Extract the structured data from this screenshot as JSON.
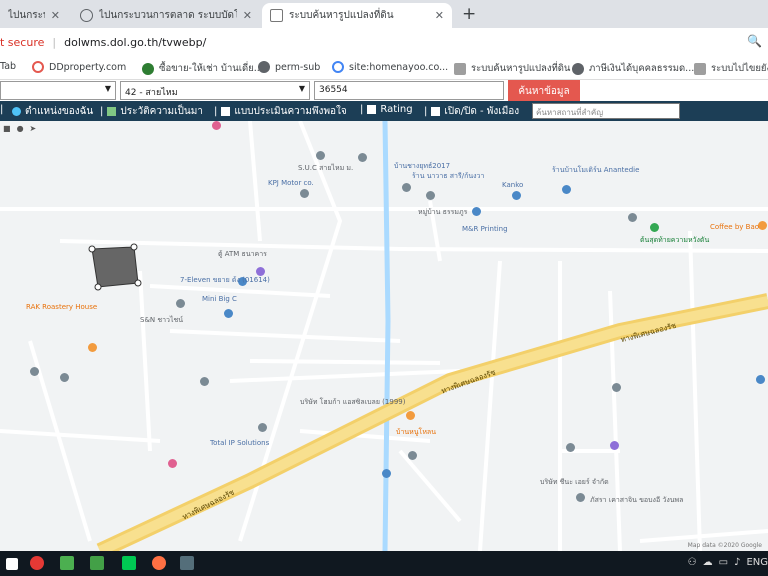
{
  "tabs": [
    {
      "title": "ไปนกระบวนการตลาด ระบบบัดโนมิดิ เ",
      "close": "✕",
      "active": false
    },
    {
      "title": "ไปนกระบวนการตลาด ระบบบัดโนมิดิ ม์",
      "close": "✕",
      "active": false
    },
    {
      "title": "ระบบค้นหารูปแปลงที่ดิน",
      "close": "✕",
      "active": true
    }
  ],
  "newtab_label": "+",
  "address": {
    "security": "t secure",
    "url": "dolwms.dol.go.th/tvwebp/",
    "zoom_icon": "🔍"
  },
  "bookmarks": [
    {
      "label": "Tab",
      "icon": "bookmark-icon",
      "color": "#888888"
    },
    {
      "label": "DDproperty.com",
      "icon": "ddproperty-icon",
      "color": "#e4584f"
    },
    {
      "label": "ซื้อขาย-ให้เช่า บ้านเดี่ย...",
      "icon": "home-icon",
      "color": "#2e7d32"
    },
    {
      "label": "perm-sub",
      "icon": "globe-icon",
      "color": "#5f6368"
    },
    {
      "label": "site:homenayoo.co...",
      "icon": "google-icon",
      "color": "#4285f4"
    },
    {
      "label": "ระบบค้นหารูปแปลงที่ดิน",
      "icon": "dol-icon",
      "color": "#5f6368"
    },
    {
      "label": "ภาษีเงินได้บุคคลธรรมด...",
      "icon": "globe-icon",
      "color": "#5f6368"
    },
    {
      "label": "ระบบไปไขยยังโฉ้...",
      "icon": "dol-icon",
      "color": "#5f6368"
    }
  ],
  "filters": {
    "province": "",
    "district": "42 - สายไหม",
    "parcel_no": "36554",
    "search_button": "ค้นหาข้อมูล"
  },
  "nav": {
    "items": [
      {
        "label": "ตำแหน่งของฉัน",
        "icon": "location-icon"
      },
      {
        "label": "ประวัติความเป็นมา",
        "icon": "history-icon"
      },
      {
        "label": "แบบประเมินความพึงพอใจ",
        "icon": "form-icon"
      },
      {
        "label": "Rating",
        "icon": "rating-icon"
      },
      {
        "label": "เปิด/ปิด - พังเมือง",
        "icon": "toggle-icon"
      }
    ],
    "search_placeholder": "ค้นหาสถานที่สำคัญ"
  },
  "map": {
    "place_labels": [
      "S.U.C สายไหม ม.",
      "KPJ Motor co.",
      "บ้านชางยุทธ์2017",
      "ร้าน นาวาธ สารี/ก้นงวา",
      "Kanko",
      "ร้านบ้านโมเดิร์น Anantedie",
      "Coffee by Bao",
      "ต้นสุดท้ายความหวังตัน",
      "M&R Printing",
      "หมู่บ้าน ธรรมภูร",
      "ตู้ ATM ธนาคาร",
      "7-Eleven ขยาย ด้ง (01614)",
      "Mini Big C",
      "S&N ชาวไชน์",
      "RAK Roastery House",
      "บริษัท โฮมก้า แอสซิลเบลย (1999)",
      "Total IP Solutions",
      "บ้านหนูโหลน",
      "บริษัท ชีนะ เอยร์ จำกัด",
      "ภัสรา เคาสาจิน ขอบงอี วังนพล"
    ],
    "road_labels": [
      "ทางพิเศษฉลองรัช",
      "ทางพิเศษฉลองรัช",
      "ทางพิเศษฉลองรัช"
    ],
    "attribution": "Map data ©2020 Google"
  },
  "taskbar": {
    "time": "",
    "lang": "ENG"
  }
}
